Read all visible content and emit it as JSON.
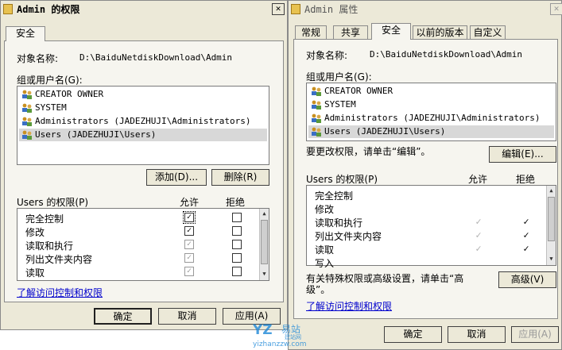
{
  "left_window": {
    "title": "Admin 的权限",
    "close_glyph": "✕",
    "tab": "安全",
    "object_label": "对象名称:",
    "object_path": "D:\\BaiduNetdiskDownload\\Admin",
    "group_label": "组或用户名(G):",
    "users": [
      "CREATOR OWNER",
      "SYSTEM",
      "Administrators (JADEZHUJI\\Administrators)",
      "Users (JADEZHUJI\\Users)"
    ],
    "add_button": "添加(D)...",
    "remove_button": "删除(R)",
    "perm_label": "Users 的权限(P)",
    "allow_header": "允许",
    "deny_header": "拒绝",
    "permissions": [
      {
        "name": "完全控制",
        "allow": true,
        "allow_enabled": true,
        "deny": false
      },
      {
        "name": "修改",
        "allow": true,
        "allow_enabled": true,
        "deny": false
      },
      {
        "name": "读取和执行",
        "allow": true,
        "allow_enabled": false,
        "deny": false
      },
      {
        "name": "列出文件夹内容",
        "allow": true,
        "allow_enabled": false,
        "deny": false
      },
      {
        "name": "读取",
        "allow": true,
        "allow_enabled": false,
        "deny": false
      }
    ],
    "link": "了解访问控制和权限",
    "ok_button": "确定",
    "cancel_button": "取消",
    "apply_button": "应用(A)"
  },
  "right_window": {
    "title": "Admin 属性",
    "tabs": [
      "常规",
      "共享",
      "安全",
      "以前的版本",
      "自定义"
    ],
    "active_tab": "安全",
    "object_label": "对象名称:",
    "object_path": "D:\\BaiduNetdiskDownload\\Admin",
    "group_label": "组或用户名(G):",
    "users": [
      "CREATOR OWNER",
      "SYSTEM",
      "Administrators (JADEZHUJI\\Administrators)",
      "Users (JADEZHUJI\\Users)"
    ],
    "change_text": "要更改权限，请单击“编辑”。",
    "edit_button": "编辑(E)...",
    "perm_label": "Users 的权限(P)",
    "allow_header": "允许",
    "deny_header": "拒绝",
    "permissions": [
      {
        "name": "完全控制",
        "allow": "",
        "deny": ""
      },
      {
        "name": "修改",
        "allow": "",
        "deny": ""
      },
      {
        "name": "读取和执行",
        "allow": "✓",
        "deny": "✓"
      },
      {
        "name": "列出文件夹内容",
        "allow": "✓",
        "deny": "✓"
      },
      {
        "name": "读取",
        "allow": "✓",
        "deny": "✓"
      },
      {
        "name": "写入",
        "allow": "",
        "deny": ""
      }
    ],
    "special_text_line1": "有关特殊权限或高级设置，请单击“高",
    "special_text_line2": "级”。",
    "advanced_button": "高级(V)",
    "link": "了解访问控制和权限",
    "ok_button": "确定",
    "cancel_button": "取消",
    "apply_button": "应用(A)"
  },
  "watermark": {
    "logo": "易站",
    "sub": "建站网",
    "url": "yizhanzzw.com"
  },
  "colors": {
    "window_bg": "#ece9d8",
    "panel_bg": "#f6f5ef",
    "link": "#0000cc",
    "selection": "#d8d8d8"
  }
}
